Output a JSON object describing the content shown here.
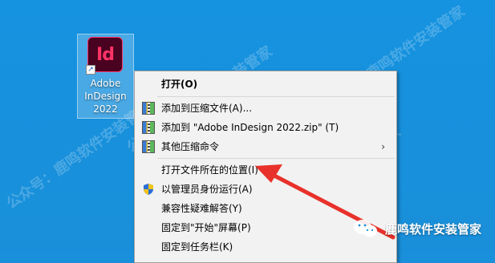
{
  "desktop_icon": {
    "logo_text": "Id",
    "label_lines": [
      "Adobe",
      "InDesign",
      "2022"
    ]
  },
  "context_menu": {
    "items": [
      {
        "label": "打开(O)",
        "icon": null,
        "bold": true
      },
      {
        "label": "添加到压缩文件(A)...",
        "icon": "archive-icon"
      },
      {
        "label": "添加到 \"Adobe InDesign 2022.zip\" (T)",
        "icon": "archive-icon"
      },
      {
        "label": "其他压缩命令",
        "icon": "archive-icon",
        "submenu": true
      },
      {
        "label": "打开文件所在的位置(I)",
        "icon": null
      },
      {
        "label": "以管理员身份运行(A)",
        "icon": "uac-shield-icon"
      },
      {
        "label": "兼容性疑难解答(Y)",
        "icon": null
      },
      {
        "label": "固定到\"开始\"屏幕(P)",
        "icon": null
      },
      {
        "label": "固定到任务栏(K)",
        "icon": null
      }
    ],
    "submenu_chevron": "›"
  },
  "watermark_text": "公众号：鹿鸣软件安装管家",
  "brand_text": "鹿鸣软件安装管家",
  "colors": {
    "desktop": "#1a90dd",
    "menu_bg": "#f2f2f2",
    "arrow": "#e8312a",
    "indesign": "#ff3366"
  }
}
